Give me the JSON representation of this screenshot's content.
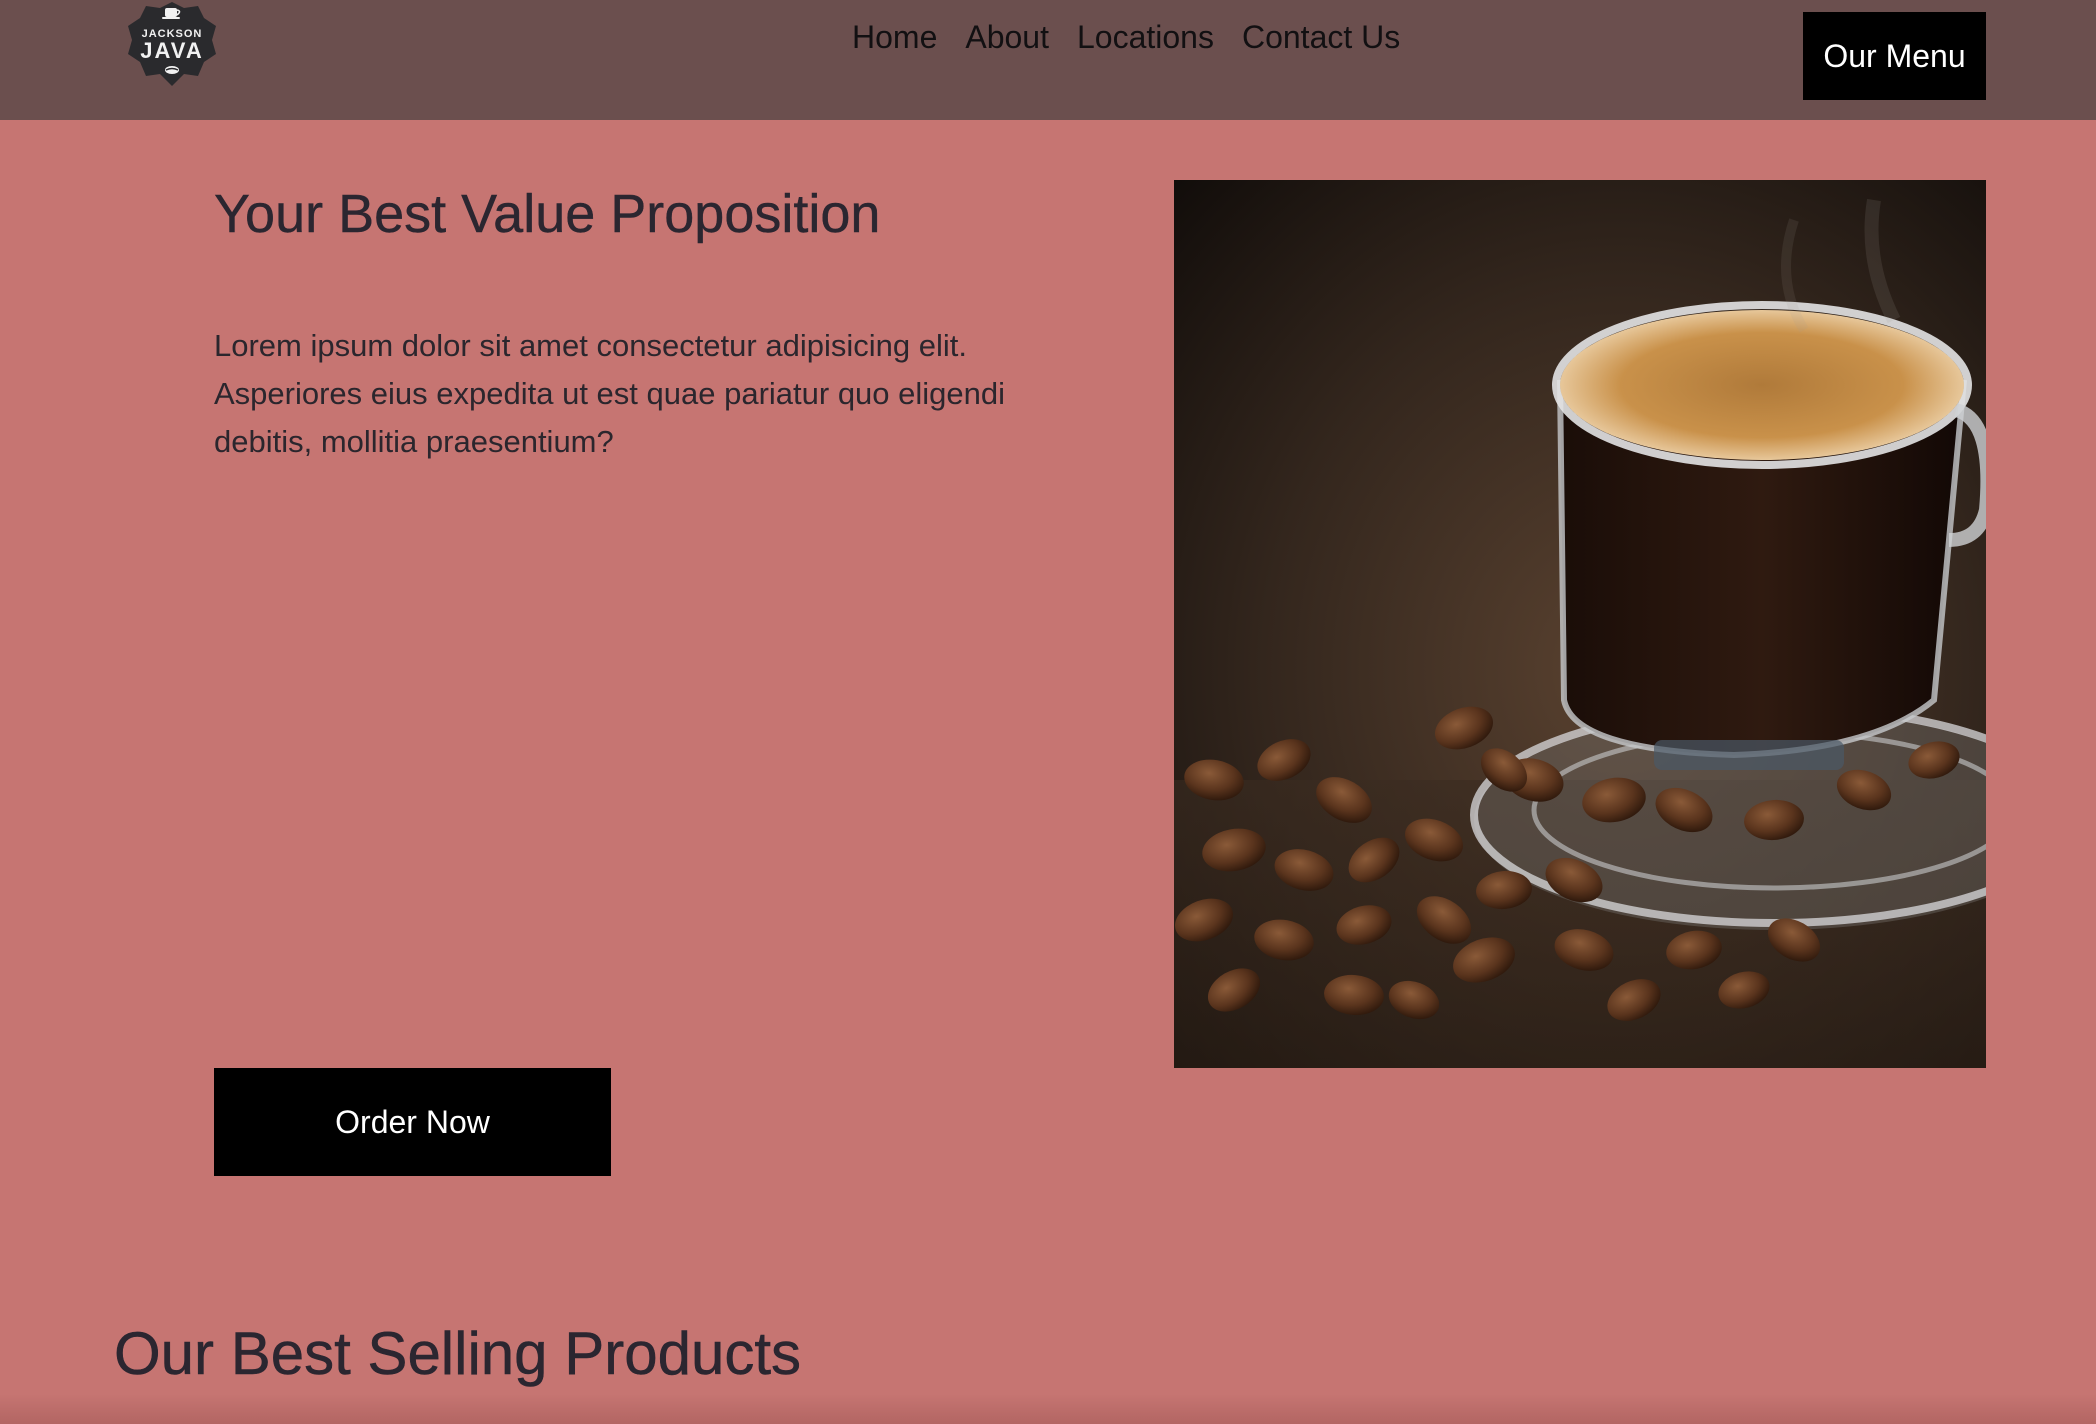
{
  "brand": {
    "logo_top_text": "JACKSON",
    "logo_main_text": "JAVA"
  },
  "nav": {
    "items": [
      {
        "label": "Home"
      },
      {
        "label": "About"
      },
      {
        "label": "Locations"
      },
      {
        "label": "Contact Us"
      }
    ],
    "menu_button": "Our Menu"
  },
  "hero": {
    "title": "Your Best Value Proposition",
    "text": "Lorem ipsum dolor sit amet consectetur adipisicing elit. Asperiores eius expedita ut est quae pariatur quo eligendi debitis, mollitia praesentium?",
    "cta": "Order Now",
    "image": "espresso-cup-with-coffee-beans"
  },
  "products": {
    "title": "Our Best Selling Products"
  },
  "colors": {
    "header_bg": "#6b4f4e",
    "page_bg": "#c67572",
    "button_bg": "#000000",
    "button_text": "#ffffff"
  }
}
